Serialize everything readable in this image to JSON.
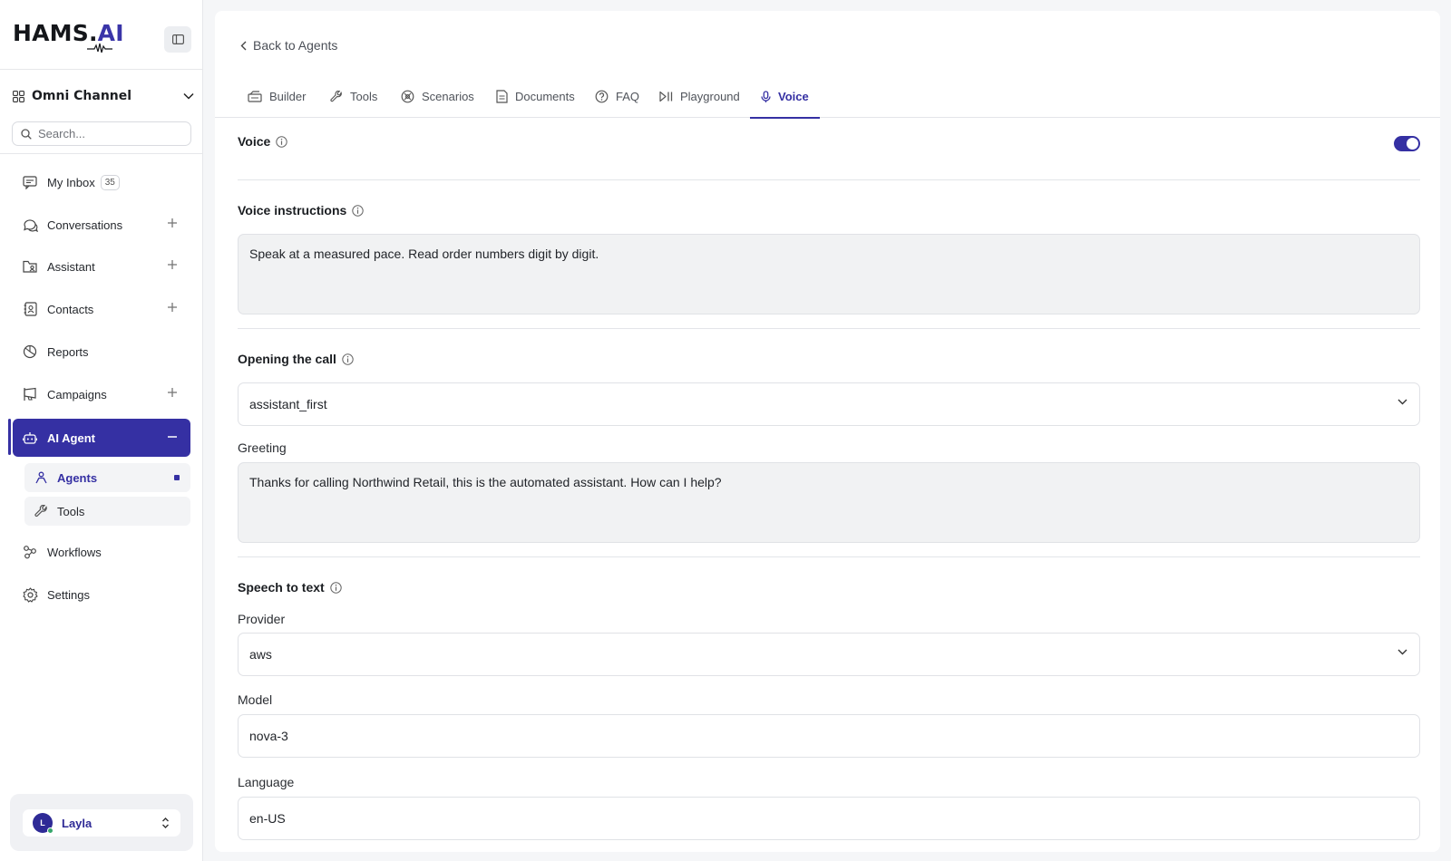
{
  "brand": {
    "logo_main": "HAMS.",
    "logo_accent": "AI"
  },
  "sidebar": {
    "channel": "Omni Channel",
    "search_placeholder": "Search...",
    "items": [
      {
        "label": "My Inbox",
        "badge": "35",
        "icon": "inbox-icon"
      },
      {
        "label": "Conversations",
        "icon": "chat-icon"
      },
      {
        "label": "Assistant",
        "icon": "folder-user-icon"
      },
      {
        "label": "Contacts",
        "icon": "contacts-icon"
      },
      {
        "label": "Reports",
        "icon": "pie-chart-icon"
      },
      {
        "label": "Campaigns",
        "icon": "megaphone-icon"
      },
      {
        "label": "AI Agent",
        "icon": "robot-icon"
      },
      {
        "label": "Workflows",
        "icon": "workflow-icon"
      },
      {
        "label": "Settings",
        "icon": "gear-icon"
      }
    ],
    "sub_items": [
      {
        "label": "Agents",
        "icon": "agent-icon"
      },
      {
        "label": "Tools",
        "icon": "wrench-icon"
      }
    ],
    "user": {
      "initial": "L",
      "name": "Layla"
    }
  },
  "main": {
    "back_label": "Back to Agents",
    "tabs": [
      {
        "label": "Builder",
        "icon": "builder-icon"
      },
      {
        "label": "Tools",
        "icon": "wrench-icon"
      },
      {
        "label": "Scenarios",
        "icon": "scenarios-icon"
      },
      {
        "label": "Documents",
        "icon": "document-icon"
      },
      {
        "label": "FAQ",
        "icon": "help-circle-icon"
      },
      {
        "label": "Playground",
        "icon": "play-pause-icon"
      },
      {
        "label": "Voice",
        "icon": "microphone-icon"
      }
    ],
    "active_tab": "Voice"
  },
  "voice": {
    "voice_label": "Voice",
    "voice_enabled": true,
    "instructions_label": "Voice instructions",
    "instructions_value": "Speak at a measured pace. Read order numbers digit by digit.",
    "opening_label": "Opening the call",
    "opening_value": "assistant_first",
    "greeting_label": "Greeting",
    "greeting_value": "Thanks for calling Northwind Retail, this is the automated assistant. How can I help?",
    "stt_label": "Speech to text",
    "provider_label": "Provider",
    "provider_value": "aws",
    "model_label": "Model",
    "model_value": "nova-3",
    "language_label": "Language",
    "language_value": "en-US"
  },
  "colors": {
    "accent": "#3530a3",
    "online": "#36a66b"
  }
}
